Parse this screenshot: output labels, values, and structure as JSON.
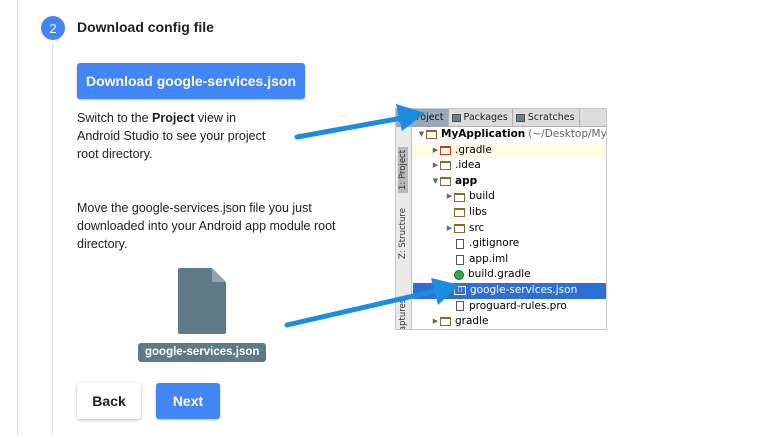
{
  "step": {
    "number": "2",
    "title": "Download config file"
  },
  "download_button": "Download google-services.json",
  "instruction1": {
    "prefix": "Switch to the ",
    "bold": "Project",
    "suffix": " view in Android Studio to see your project root directory."
  },
  "instruction2": "Move the google-services.json file you just downloaded into your Android app module root directory.",
  "file_label": "google-services.json",
  "buttons": {
    "back": "Back",
    "next": "Next"
  },
  "android_studio": {
    "tabs": [
      "Project",
      "Packages",
      "Scratches"
    ],
    "side_labels": [
      "1: Project",
      "Z: Structure",
      "Captures"
    ],
    "tree": {
      "root": "MyApplication",
      "root_path": "(~/Desktop/My",
      "gradle_hidden": ".gradle",
      "idea": ".idea",
      "app": "app",
      "build": "build",
      "libs": "libs",
      "src": "src",
      "gitignore": ".gitignore",
      "app_iml": "app.iml",
      "build_gradle": "build.gradle",
      "google_services": "google-services.json",
      "proguard": "proguard-rules.pro",
      "gradle": "gradle"
    }
  },
  "colors": {
    "primary": "#4285f4",
    "selection": "#2d6fd6",
    "file_icon": "#5f7a87",
    "arrow": "#1a8de0"
  }
}
